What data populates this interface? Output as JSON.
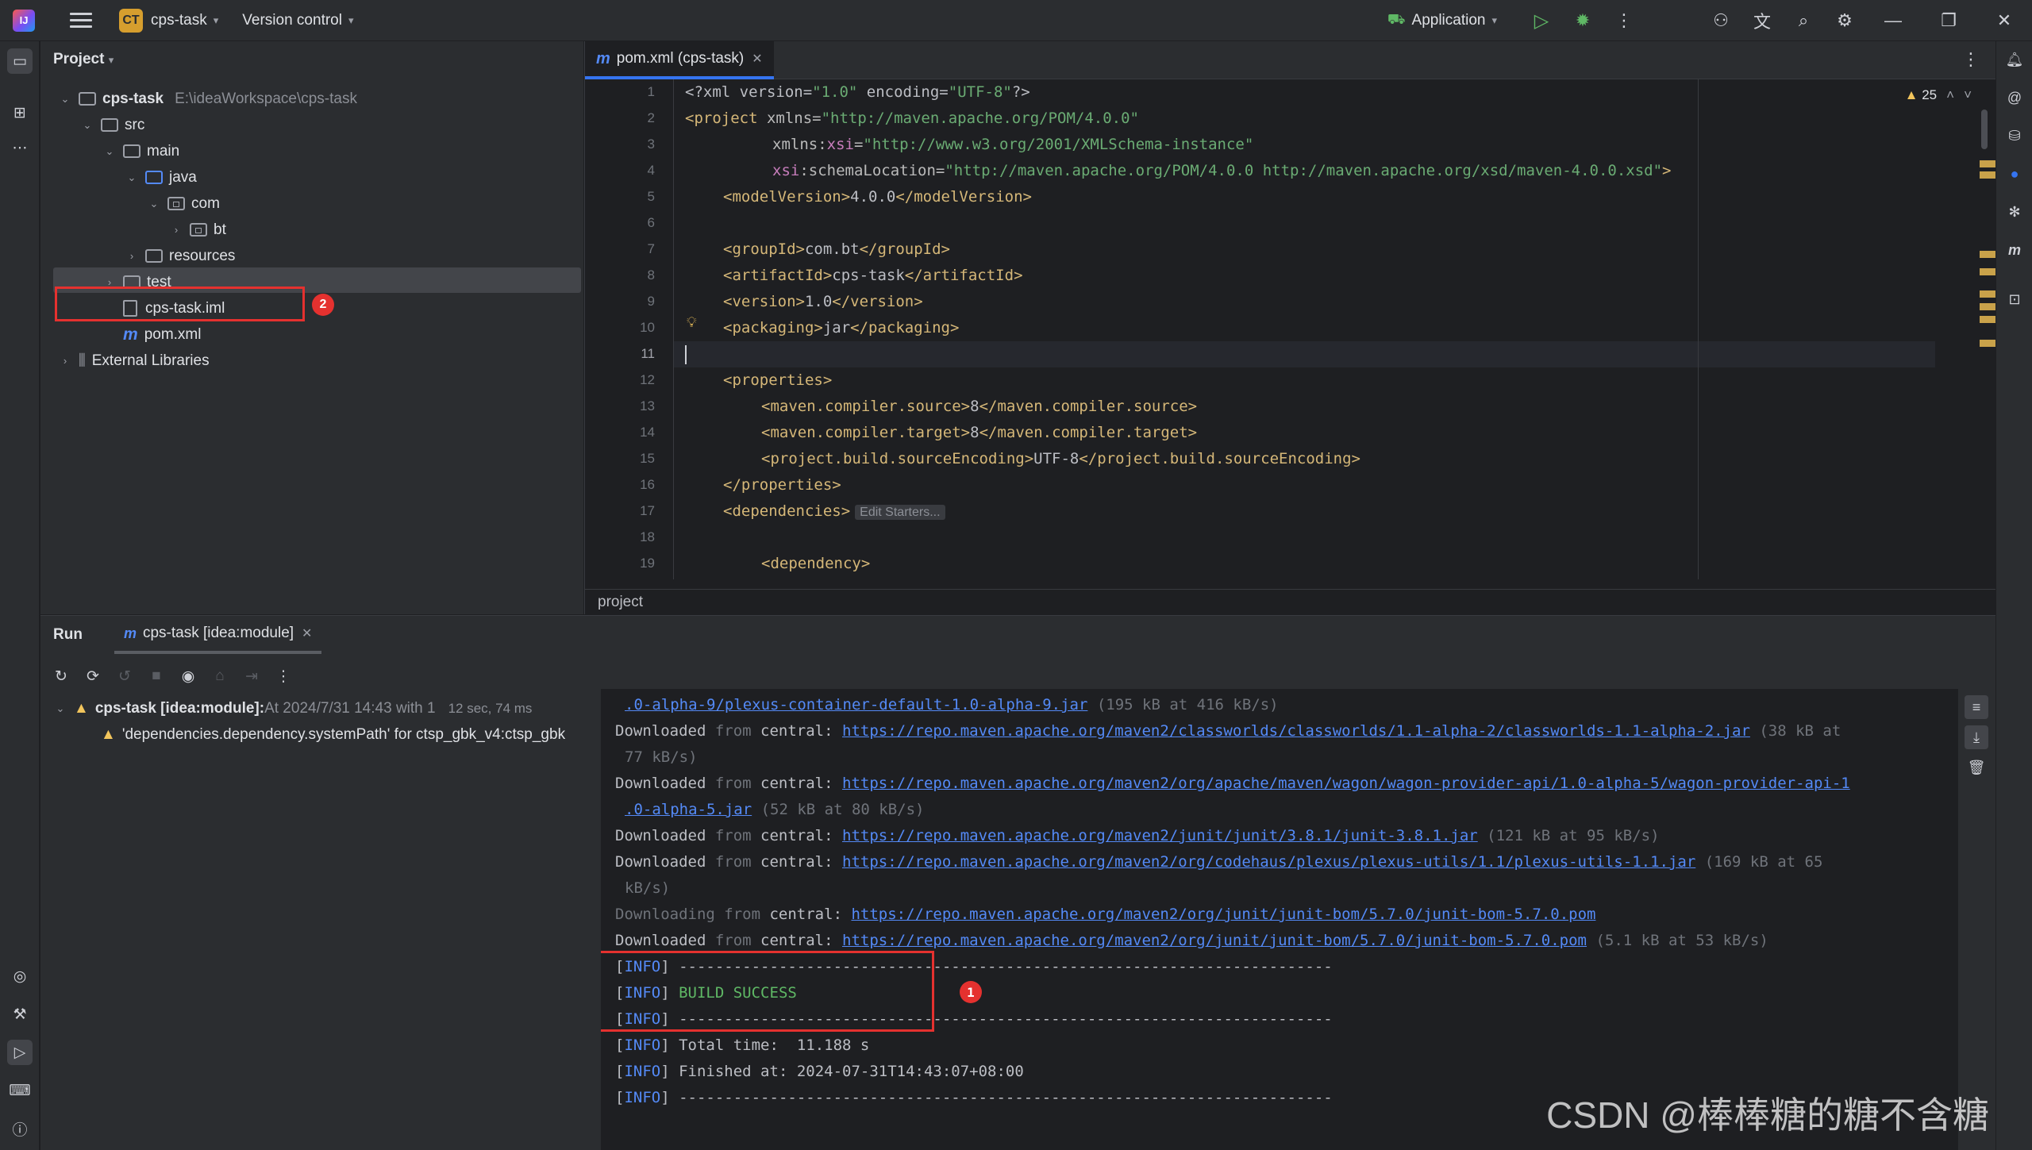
{
  "titlebar": {
    "logo": "IJ",
    "project_badge": "CT",
    "project_name": "cps-task",
    "version_control": "Version control",
    "run_config": "Application",
    "icons": [
      "hamburger-icon",
      "run-icon",
      "debug-icon",
      "more-vertical-icon",
      "add-user-icon",
      "translate-icon",
      "search-icon",
      "settings-icon",
      "minimize-icon",
      "restore-icon",
      "close-icon"
    ]
  },
  "project_panel": {
    "title": "Project",
    "root": {
      "name": "cps-task",
      "path": "E:\\ideaWorkspace\\cps-task"
    },
    "items": [
      {
        "label": "src"
      },
      {
        "label": "main"
      },
      {
        "label": "java"
      },
      {
        "label": "com"
      },
      {
        "label": "bt"
      },
      {
        "label": "resources"
      },
      {
        "label": "test"
      },
      {
        "label": "cps-task.iml"
      },
      {
        "label": "pom.xml"
      },
      {
        "label": "External Libraries"
      }
    ],
    "annotation": "2"
  },
  "editor": {
    "tab_label": "pom.xml (cps-task)",
    "warnings_count": "25",
    "line_numbers": [
      "1",
      "2",
      "3",
      "4",
      "5",
      "6",
      "7",
      "8",
      "9",
      "10",
      "11",
      "12",
      "13",
      "14",
      "15",
      "16",
      "17",
      "18",
      "19"
    ],
    "lines": {
      "l1_a": "<?xml version=",
      "l1_b": "\"1.0\"",
      "l1_c": " encoding=",
      "l1_d": "\"UTF-8\"",
      "l1_e": "?>",
      "l2_a": "<project ",
      "l2_b": "xmlns=",
      "l2_c": "\"http://maven.apache.org/POM/4.0.0\"",
      "l3_a": "xmlns:",
      "l3_b": "xsi",
      "l3_c": "=",
      "l3_d": "\"http://www.w3.org/2001/XMLSchema-instance\"",
      "l4_a": "xsi",
      "l4_b": ":schemaLocation=",
      "l4_c": "\"http://maven.apache.org/POM/4.0.0 http://maven.apache.org/xsd/maven-4.0.0.xsd\"",
      "l4_d": ">",
      "l5_a": "<modelVersion>",
      "l5_b": "4.0.0",
      "l5_c": "</modelVersion>",
      "l7_a": "<groupId>",
      "l7_b": "com.bt",
      "l7_c": "</groupId>",
      "l8_a": "<artifactId>",
      "l8_b": "cps-task",
      "l8_c": "</artifactId>",
      "l9_a": "<version>",
      "l9_b": "1.0",
      "l9_c": "</version>",
      "l10_a": "<packaging>",
      "l10_b": "jar",
      "l10_c": "</packaging>",
      "l12": "<properties>",
      "l13_a": "<maven.compiler.source>",
      "l13_b": "8",
      "l13_c": "</maven.compiler.source>",
      "l14_a": "<maven.compiler.target>",
      "l14_b": "8",
      "l14_c": "</maven.compiler.target>",
      "l15_a": "<project.build.sourceEncoding>",
      "l15_b": "UTF-8",
      "l15_c": "</project.build.sourceEncoding>",
      "l16": "</properties>",
      "l17": "<dependencies>",
      "l17_hint": "Edit Starters...",
      "l19": "<dependency>"
    },
    "breadcrumb": "project"
  },
  "run_panel": {
    "label": "Run",
    "tab_label": "cps-task [idea:module]",
    "tree": {
      "root_name": "cps-task [idea:module]:",
      "root_detail": " At 2024/7/31 14:43 with 1",
      "root_time": "12 sec, 74 ms",
      "warning": "'dependencies.dependency.systemPath' for ctsp_gbk_v4:ctsp_gbk"
    },
    "console": {
      "c1_link": ".0-alpha-9/plexus-container-default-1.0-alpha-9.jar",
      "c1_tail": " (195 kB at 416 kB/s)",
      "c2_a": "Downloaded",
      "c2_b": " from ",
      "c2_c": "central",
      "c2_d": ": ",
      "c2_link": "https://repo.maven.apache.org/maven2/classworlds/classworlds/1.1-alpha-2/classworlds-1.1-alpha-2.jar",
      "c2_tail": " (38 kB at",
      "c3": "77 kB/s)",
      "c4_a": "Downloaded",
      "c4_b": " from ",
      "c4_c": "central",
      "c4_d": ": ",
      "c4_link": "https://repo.maven.apache.org/maven2/org/apache/maven/wagon/wagon-provider-api/1.0-alpha-5/wagon-provider-api-1",
      "c5_link": ".0-alpha-5.jar",
      "c5_tail": " (52 kB at 80 kB/s)",
      "c6_a": "Downloaded",
      "c6_b": " from ",
      "c6_c": "central",
      "c6_d": ": ",
      "c6_link": "https://repo.maven.apache.org/maven2/junit/junit/3.8.1/junit-3.8.1.jar",
      "c6_tail": " (121 kB at 95 kB/s)",
      "c7_a": "Downloaded",
      "c7_b": " from ",
      "c7_c": "central",
      "c7_d": ": ",
      "c7_link": "https://repo.maven.apache.org/maven2/org/codehaus/plexus/plexus-utils/1.1/plexus-utils-1.1.jar",
      "c7_tail": " (169 kB at 65",
      "c8": "kB/s)",
      "c9_a": "Downloading",
      "c9_b": " from ",
      "c9_c": "central",
      "c9_d": ": ",
      "c9_link": "https://repo.maven.apache.org/maven2/org/junit/junit-bom/5.7.0/junit-bom-5.7.0.pom",
      "c10_a": "Downloaded",
      "c10_b": " from ",
      "c10_c": "central",
      "c10_d": ": ",
      "c10_link": "https://repo.maven.apache.org/maven2/org/junit/junit-bom/5.7.0/junit-bom-5.7.0.pom",
      "c10_tail": " (5.1 kB at 53 kB/s)",
      "info_tag": "INFO",
      "c11": " ------------------------------------------------------------------------",
      "c12": "BUILD SUCCESS",
      "c13": " ------------------------------------------------------------------------",
      "c14": " Total time:  11.188 s",
      "c15": " Finished at: 2024-07-31T14:43:07+08:00",
      "c16": " ------------------------------------------------------------------------"
    },
    "annotation": "1"
  },
  "watermark": "CSDN @棒棒糖的糖不含糖",
  "colors": {
    "accent": "#3574f0",
    "annotation_red": "#e5312f",
    "success_green": "#5fb865",
    "warning_yellow": "#f2c55c"
  }
}
